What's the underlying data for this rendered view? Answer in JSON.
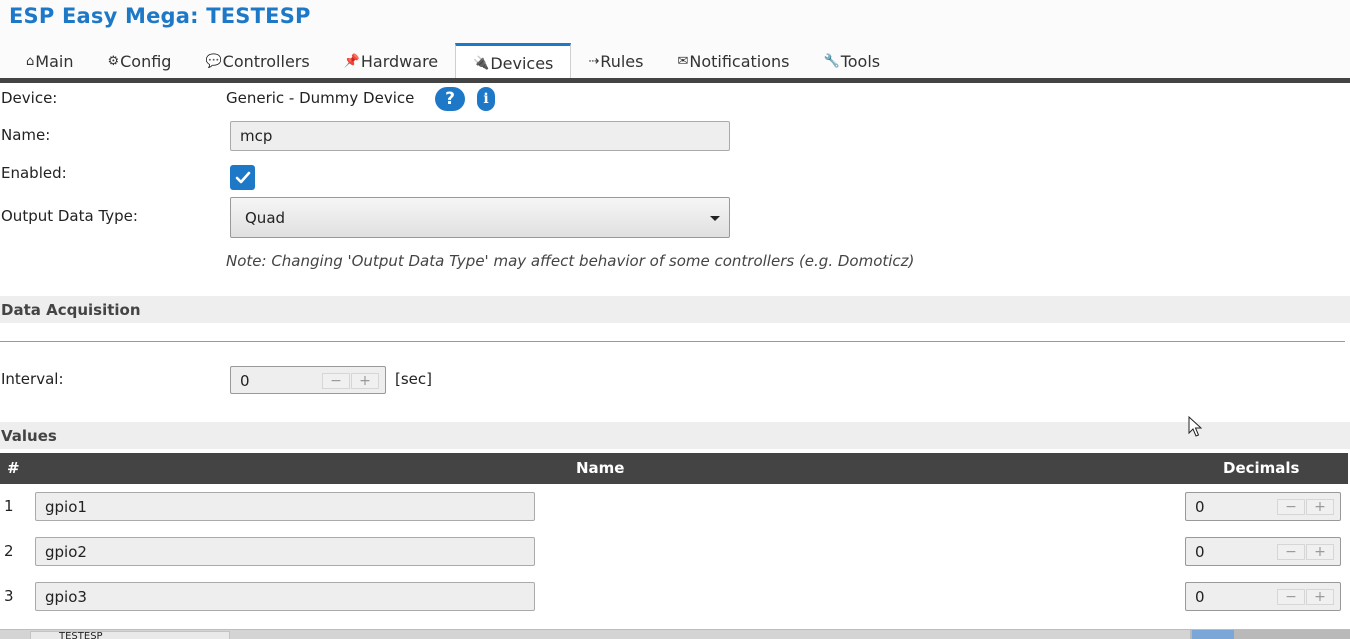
{
  "app": {
    "title": "ESP Easy Mega: TESTESP"
  },
  "tabs": [
    {
      "icon": "⌂",
      "label": "Main"
    },
    {
      "icon": "⚙",
      "label": "Config"
    },
    {
      "icon": "💬",
      "label": "Controllers"
    },
    {
      "icon": "📌",
      "label": "Hardware"
    },
    {
      "icon": "🔌",
      "label": "Devices",
      "active": true
    },
    {
      "icon": "⇢",
      "label": "Rules"
    },
    {
      "icon": "✉",
      "label": "Notifications"
    },
    {
      "icon": "🔧",
      "label": "Tools"
    }
  ],
  "device": {
    "label": "Device:",
    "value": "Generic - Dummy Device",
    "help_symbol": "?",
    "info_symbol": "i"
  },
  "name": {
    "label": "Name:",
    "value": "mcp"
  },
  "enabled": {
    "label": "Enabled:",
    "checked": true
  },
  "output_type": {
    "label": "Output Data Type:",
    "selected": "Quad",
    "note": "Note: Changing 'Output Data Type' may affect behavior of some controllers (e.g. Domoticz)"
  },
  "data_acquisition": {
    "header": "Data Acquisition",
    "interval_label": "Interval:",
    "interval_value": "0",
    "interval_unit": "[sec]"
  },
  "values": {
    "header": "Values",
    "columns": {
      "index": "#",
      "name": "Name",
      "decimals": "Decimals"
    },
    "rows": [
      {
        "index": "1",
        "name": "gpio1",
        "decimals": "0"
      },
      {
        "index": "2",
        "name": "gpio2",
        "decimals": "0"
      },
      {
        "index": "3",
        "name": "gpio3",
        "decimals": "0"
      }
    ]
  },
  "stepper": {
    "minus": "−",
    "plus": "+"
  },
  "taskbar": {
    "window_label": "TESTESP"
  },
  "colors": {
    "accent": "#1e78c8",
    "header_dark": "#444444",
    "section_bg": "#eeeeee"
  }
}
